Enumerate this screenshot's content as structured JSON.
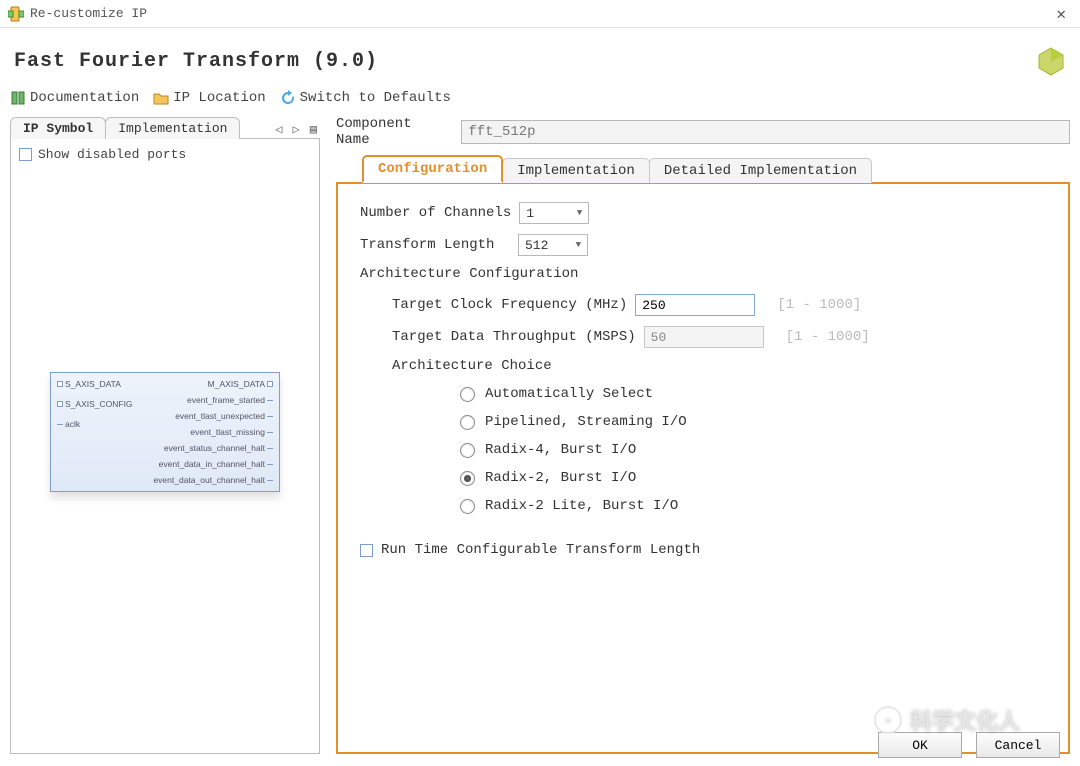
{
  "window": {
    "title": "Re-customize IP"
  },
  "header": {
    "title": "Fast Fourier Transform (9.0)"
  },
  "links": {
    "documentation": "Documentation",
    "ip_location": "IP Location",
    "switch_defaults": "Switch to Defaults"
  },
  "left": {
    "tabs": {
      "symbol": "IP Symbol",
      "impl": "Implementation"
    },
    "show_disabled": "Show disabled ports",
    "ports_left": [
      "S_AXIS_DATA",
      "S_AXIS_CONFIG",
      "aclk"
    ],
    "ports_right": [
      "M_AXIS_DATA",
      "event_frame_started",
      "event_tlast_unexpected",
      "event_tlast_missing",
      "event_status_channel_halt",
      "event_data_in_channel_halt",
      "event_data_out_channel_halt"
    ]
  },
  "right": {
    "cname_label": "Component Name",
    "cname_value": "fft_512p",
    "tabs": {
      "configuration": "Configuration",
      "implementation": "Implementation",
      "detailed": "Detailed Implementation"
    },
    "num_channels_label": "Number of Channels",
    "num_channels": "1",
    "transform_len_label": "Transform Length",
    "transform_len": "512",
    "arch_config": "Architecture Configuration",
    "tcf_label": "Target Clock Frequency (MHz)",
    "tcf_value": "250",
    "tdt_label": "Target Data Throughput (MSPS)",
    "tdt_value": "50",
    "range_hint": "[1 - 1000]",
    "arch_choice": "Architecture Choice",
    "opts": {
      "auto": "Automatically Select",
      "pipe": "Pipelined, Streaming I/O",
      "r4": "Radix-4, Burst I/O",
      "r2": "Radix-2, Burst I/O",
      "r2l": "Radix-2 Lite, Burst I/O"
    },
    "runtime_cfg": "Run Time Configurable Transform Length"
  },
  "footer": {
    "ok": "OK",
    "cancel": "Cancel"
  },
  "watermark": "科学文化人"
}
